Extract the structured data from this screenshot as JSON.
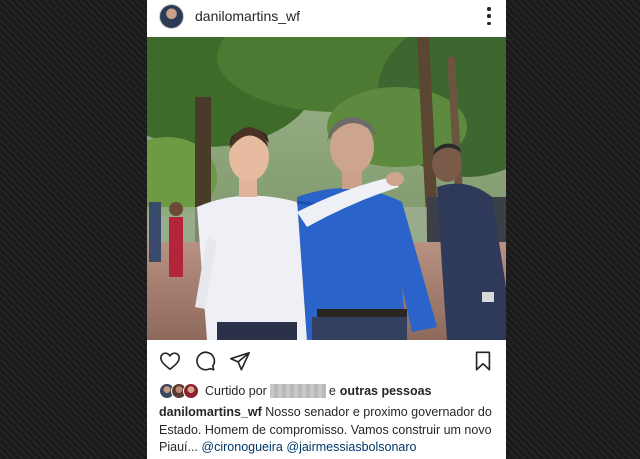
{
  "post": {
    "username": "danilomartins_wf",
    "liked_prefix": "Curtido por",
    "liked_suffix": "e",
    "liked_others": "outras pessoas",
    "caption_user": "danilomartins_wf",
    "caption_text": "Nosso senador e proximo governador do Estado. Homem de compromisso. Vamos construir um novo Piauí...",
    "mentions": [
      "@cironogueira",
      "@jairmessiasbolsonaro"
    ]
  },
  "icons": {
    "more": "more-vertical-icon",
    "like": "heart-icon",
    "comment": "comment-bubble-icon",
    "share": "paper-plane-icon",
    "save": "bookmark-icon"
  },
  "colors": {
    "text": "#262626",
    "mention": "#00376b",
    "background": "#1b1b1b"
  }
}
